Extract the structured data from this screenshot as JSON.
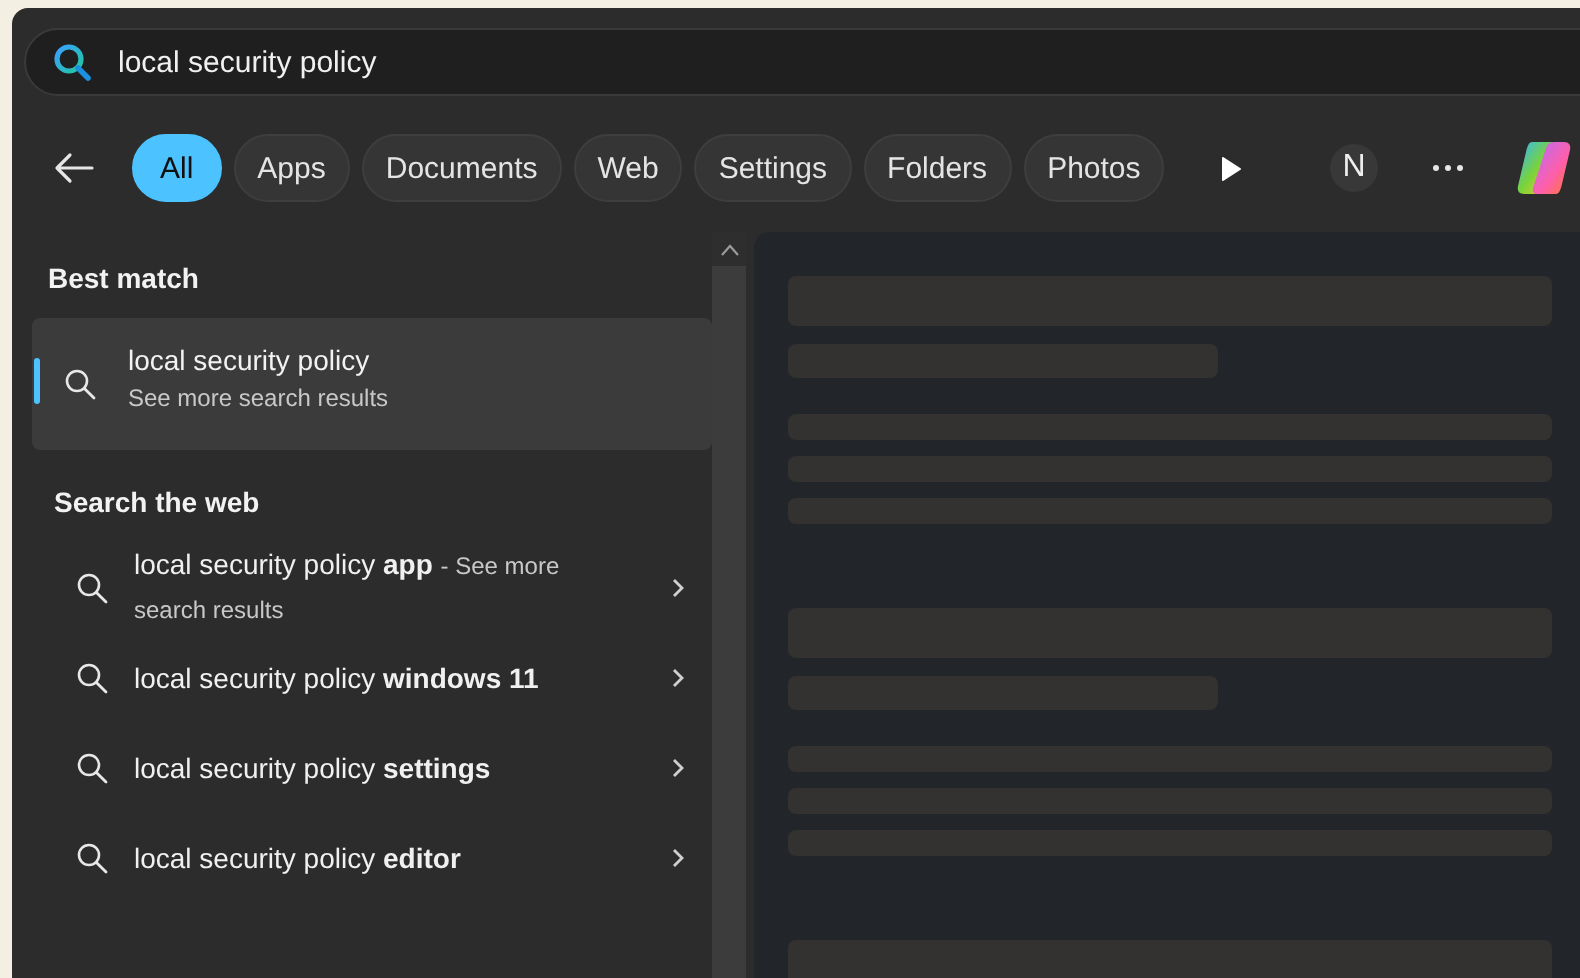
{
  "search": {
    "value": "local security policy"
  },
  "filters": [
    {
      "label": "All",
      "selected": true
    },
    {
      "label": "Apps",
      "selected": false
    },
    {
      "label": "Documents",
      "selected": false
    },
    {
      "label": "Web",
      "selected": false
    },
    {
      "label": "Settings",
      "selected": false
    },
    {
      "label": "Folders",
      "selected": false
    },
    {
      "label": "Photos",
      "selected": false
    }
  ],
  "account": {
    "initial": "N"
  },
  "best_match": {
    "heading": "Best match",
    "title": "local security policy",
    "subtitle": "See more search results",
    "selected": true
  },
  "web": {
    "heading": "Search the web",
    "items": [
      {
        "query": "local security policy **app**",
        "suffix": "- See more search results"
      },
      {
        "query": "local security policy **windows 11**"
      },
      {
        "query": "local security policy **settings**"
      },
      {
        "query": "local security policy **editor**"
      }
    ]
  }
}
